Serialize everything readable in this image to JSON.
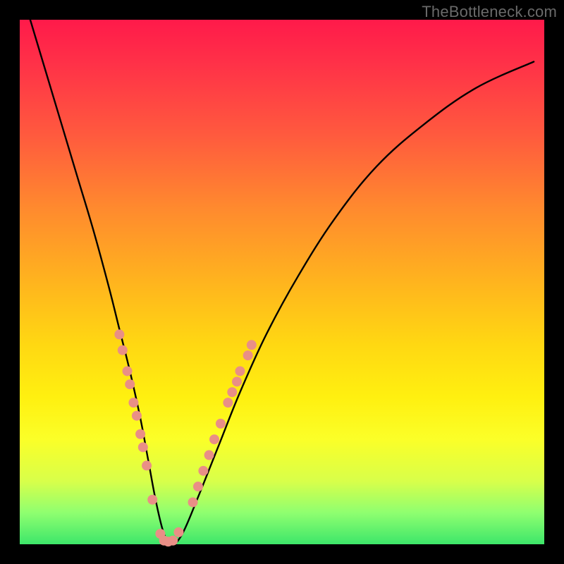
{
  "watermark": "TheBottleneck.com",
  "chart_data": {
    "type": "line",
    "title": "",
    "xlabel": "",
    "ylabel": "",
    "xlim": [
      0,
      100
    ],
    "ylim": [
      0,
      100
    ],
    "background_gradient": [
      "#ff1a4a",
      "#ff8a2e",
      "#ffd812",
      "#fbff28",
      "#3de66a"
    ],
    "series": [
      {
        "name": "bottleneck-curve",
        "color": "#000000",
        "x": [
          2,
          5,
          8,
          11,
          14,
          17,
          19,
          21,
          23,
          24.5,
          26,
          27.5,
          29,
          31,
          34,
          38,
          42,
          47,
          53,
          60,
          68,
          77,
          87,
          98
        ],
        "y": [
          100,
          90,
          80,
          70,
          60,
          49,
          41,
          33,
          24,
          16,
          8,
          2,
          0,
          2,
          9,
          19,
          29,
          40,
          51,
          62,
          72,
          80,
          87,
          92
        ]
      }
    ],
    "markers": {
      "name": "highlight-dots",
      "color": "#e98f86",
      "radius_px": 7,
      "points": [
        {
          "x": 19.0,
          "y": 40.0
        },
        {
          "x": 19.6,
          "y": 37.0
        },
        {
          "x": 20.5,
          "y": 33.0
        },
        {
          "x": 21.0,
          "y": 30.5
        },
        {
          "x": 21.7,
          "y": 27.0
        },
        {
          "x": 22.3,
          "y": 24.5
        },
        {
          "x": 23.0,
          "y": 21.0
        },
        {
          "x": 23.5,
          "y": 18.5
        },
        {
          "x": 24.2,
          "y": 15.0
        },
        {
          "x": 25.3,
          "y": 8.5
        },
        {
          "x": 26.8,
          "y": 2.0
        },
        {
          "x": 27.5,
          "y": 0.7
        },
        {
          "x": 28.3,
          "y": 0.5
        },
        {
          "x": 29.2,
          "y": 0.7
        },
        {
          "x": 30.3,
          "y": 2.3
        },
        {
          "x": 33.0,
          "y": 8.0
        },
        {
          "x": 34.0,
          "y": 11.0
        },
        {
          "x": 35.0,
          "y": 14.0
        },
        {
          "x": 36.1,
          "y": 17.0
        },
        {
          "x": 37.1,
          "y": 20.0
        },
        {
          "x": 38.3,
          "y": 23.0
        },
        {
          "x": 39.7,
          "y": 27.0
        },
        {
          "x": 40.5,
          "y": 29.0
        },
        {
          "x": 41.4,
          "y": 31.0
        },
        {
          "x": 42.0,
          "y": 33.0
        },
        {
          "x": 43.5,
          "y": 36.0
        },
        {
          "x": 44.2,
          "y": 38.0
        }
      ]
    }
  }
}
